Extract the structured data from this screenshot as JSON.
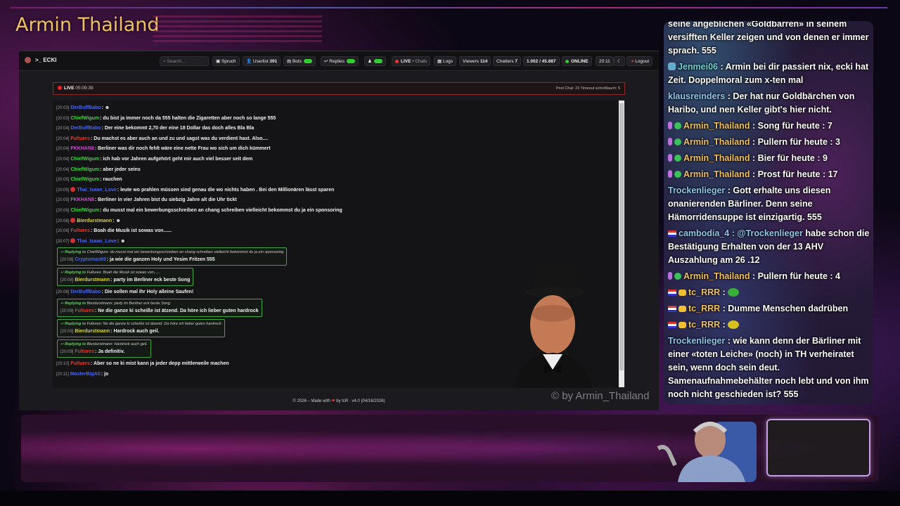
{
  "brand": {
    "title": "Armin Thailand"
  },
  "navbar": {
    "logo": ">_ ECKI",
    "search_placeholder": "Search...",
    "items": {
      "spruch": "Spruch",
      "userlist": "Userlist",
      "userlist_count": "391",
      "bots": "Bots",
      "replies": "Replies",
      "live": "LIVE",
      "live_sub": "• Chats",
      "logs": "Logs",
      "viewers": "Viewers",
      "viewers_count": "114",
      "chatters": "Chatters",
      "chatters_count": "7",
      "ratio": "1.002 / 45.887",
      "online": "ONLINE",
      "time": "20:11",
      "logout": "Logout"
    }
  },
  "live_bar": {
    "label": "LIVE",
    "uptime": "05:09:39",
    "stats": "Post Chat: 23 Timeout schnittlauch: 5"
  },
  "colors": {
    "green_user": "#3fd23f",
    "blue_user": "#4a66e8",
    "red_user": "#e03a2a",
    "pink_user": "#d24ad2",
    "yellow_user": "#d6d63a",
    "reply_border": "#3fa83f"
  },
  "messages": [
    {
      "time": "[20:03]",
      "user": "DerBuffBabo",
      "color": "blue",
      "text": ""
    },
    {
      "time": "[20:03]",
      "user": "ChiefWigum",
      "color": "green",
      "text": "du bist ja immer noch da 555 halten die Zigaretten aber noch so lange 555"
    },
    {
      "time": "[20:04]",
      "user": "DerBuffBabo",
      "color": "blue",
      "text": "Der eine bekommt 2,70 der eine 18 Dollar das doch alles Bla Bla"
    },
    {
      "time": "[20:04]",
      "user": "Fultures",
      "color": "red",
      "text": "Du machst es aber auch an und zu und sagst was du verdient hast. Also...."
    },
    {
      "time": "[20:04]",
      "user": "FKKHAN8",
      "color": "pink",
      "text": "Berliner was dir noch fehlt wäre eine nette Frau wo sich um dich kümmert"
    },
    {
      "time": "[20:04]",
      "user": "ChiefWigum",
      "color": "green",
      "text": "ich hab vor Jahren aufgehört geht mir auch viel besser seit dem"
    },
    {
      "time": "[20:04]",
      "user": "ChiefWigum",
      "color": "green",
      "text": "aber jeder seins"
    },
    {
      "time": "[20:05]",
      "user": "ChiefWigum",
      "color": "green",
      "text": "rauchen"
    },
    {
      "time": "[20:05]",
      "user": "Thai_Isaan_Love",
      "color": "blue",
      "text": "leute wo prahlen müssen sind genau die wo nichts haben . Bei den Millionären lässt sparen",
      "badge": true
    },
    {
      "time": "[20:05]",
      "user": "FKKHAN8",
      "color": "pink",
      "text": "Berliner in vier Jahren bist du siebzig Jahre alt die Uhr tickt"
    },
    {
      "time": "[20:06]",
      "user": "ChiefWigum",
      "color": "green",
      "text": "du musst mal ein bewerbungsschreiben an chang schreiben vielleicht bekommst du ja ein sponsoring"
    },
    {
      "time": "[20:06]",
      "user": "Bierdurstmann",
      "color": "yellow",
      "text": "",
      "badge": true
    },
    {
      "time": "[20:06]",
      "user": "Fultures",
      "color": "red",
      "text": "Boah die Musik ist sowas von......"
    },
    {
      "time": "[20:07]",
      "user": "Thai_Isaan_Love",
      "color": "blue",
      "text": "",
      "badge": true
    }
  ],
  "replies": [
    {
      "reply_label": "Replying to",
      "reply_to": "ChiefWigum: du musst mal ein bewerbungsschreiben an chang schreiben vielleicht bekommst du ja ein sponsoring",
      "time": "[20:08]",
      "user": "Cryptomas69",
      "color": "blue",
      "text": "ja wie die ganzen Holy und Yesim Fritzen 555"
    },
    {
      "reply_label": "Replying to",
      "reply_to": "Fultures: Boah die Musik ist sowas von......",
      "time": "[20:08]",
      "user": "Bierdurstmann",
      "color": "yellow",
      "text": "party im Berliner eck beste Song"
    }
  ],
  "mid_message": {
    "time": "[20:08]",
    "user": "DerBuffBabo",
    "color": "blue",
    "text": "Die sollen mal ihr Holy alleine Saufen!"
  },
  "replies2": [
    {
      "reply_label": "Replying to",
      "reply_to": "Bierdurstmann: party im Berliner eck beste Song",
      "time": "[20:09]",
      "user": "Fultures",
      "color": "red",
      "text": "Ne die ganze ki scheiße ist ätzend. Da höre ich lieber guten hardrock"
    },
    {
      "reply_label": "Replying to",
      "reply_to": "Fultures: Ne die ganze ki scheiße ist ätzend. Da höre ich lieber guten hardrock",
      "time": "[20:09]",
      "user": "Bierdurstmann",
      "color": "yellow",
      "text": "Hardrock auch geil."
    },
    {
      "reply_label": "Replying to",
      "reply_to": "Bierdurstmann: Hardrock auch geil.",
      "time": "[20:09]",
      "user": "Fultures",
      "color": "red",
      "text": "Ja definitiv."
    }
  ],
  "tail_messages": [
    {
      "time": "[20:10]",
      "user": "Fultures",
      "color": "red",
      "text": "Aber so ne ki mist kann ja jeder depp mittlerweile machen"
    },
    {
      "time": "[20:11]",
      "user": "MasterBigAli",
      "color": "blue",
      "text": "jo"
    }
  ],
  "footer": {
    "prefix": "© 2026 – Made with",
    "suffix": "by tcR · v4.0 (04/16/2026)"
  },
  "watermark": "© by Armin_Thailand",
  "overlay": {
    "messages": [
      {
        "user": "",
        "cls": "",
        "text": "seine angeblichen «Goldbarren» in seinem versifften Keller zeigen und von denen er immer sprach. 555"
      },
      {
        "user": "Jenmei06",
        "cls": "teal",
        "text": ": Armin bei dir passiert nix, ecki hat Zeit. Doppelmoral zum x-ten mal",
        "icon": "pix"
      },
      {
        "user": "klausreinders",
        "cls": "",
        "text": ": Der hat nur Goldbärchen von Haribo, und nen Keller gibt's hier nicht."
      },
      {
        "user": "Armin_Thailand",
        "cls": "gold",
        "text": ": Song für heute : 7",
        "icon": "mod"
      },
      {
        "user": "Armin_Thailand",
        "cls": "gold",
        "text": ": Pullern für heute : 3",
        "icon": "mod"
      },
      {
        "user": "Armin_Thailand",
        "cls": "gold",
        "text": ": Bier für heute : 9",
        "icon": "mod"
      },
      {
        "user": "Armin_Thailand",
        "cls": "gold",
        "text": ": Prost für heute : 17",
        "icon": "mod"
      },
      {
        "user": "Trockenlieger",
        "cls": "",
        "text": ": Gott erhalte uns diesen onanierenden Bärliner. Denn seine Hämorridensuppe ist einzigartig. 555"
      },
      {
        "user": "cambodia_4",
        "cls": "",
        "text": "habe schon die Bestätigung Erhalten von der 13 AHV Auszahlung am 26 .12",
        "mention": ": @Trockenlieger",
        "icon": "flag"
      },
      {
        "user": "Armin_Thailand",
        "cls": "gold",
        "text": ": Pullern für heute : 4",
        "icon": "mod"
      },
      {
        "user": "tc_RRR",
        "cls": "gold",
        "text": ":",
        "icon": "flagcrown",
        "emote": "#3ab03a"
      },
      {
        "user": "tc_RRR",
        "cls": "gold",
        "text": ": Dumme Menschen dadrüben",
        "icon": "flagcrown"
      },
      {
        "user": "tc_RRR",
        "cls": "gold",
        "text": ":",
        "icon": "flagcrown",
        "emote": "#d6c020"
      },
      {
        "user": "Trockenlieger",
        "cls": "",
        "text": ": wie kann denn der Bärliner mit einer «toten Leiche» (noch) in TH verheiratet sein, wenn doch sein deut. Samenaufnahmebehälter noch lebt und von ihm noch nicht geschieden ist? 555"
      }
    ]
  }
}
